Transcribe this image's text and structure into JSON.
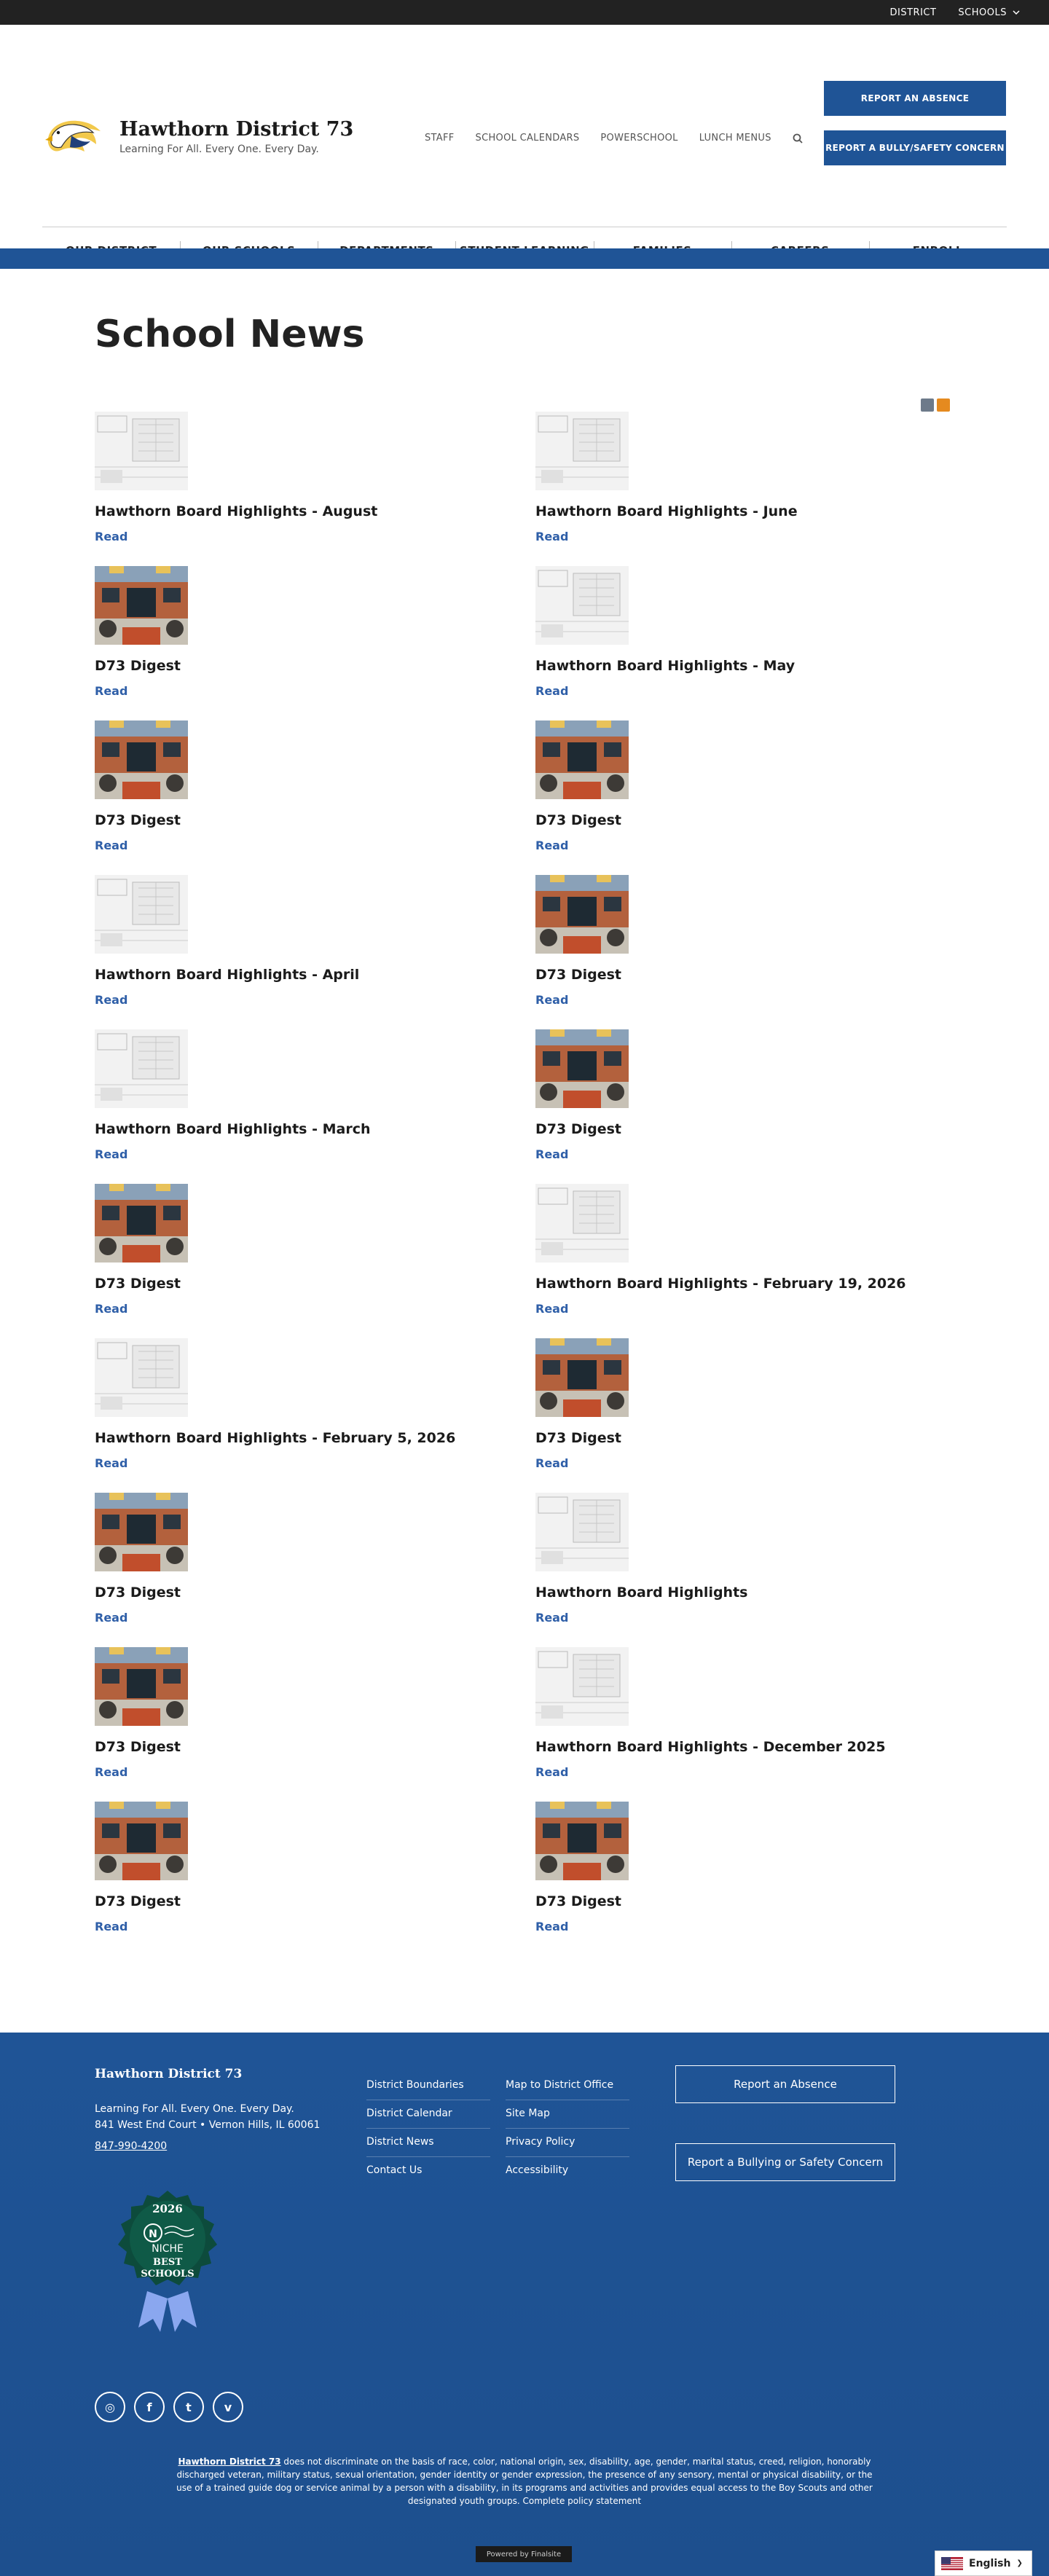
{
  "topbar": {
    "district": "DISTRICT",
    "schools": "SCHOOLS"
  },
  "brand": {
    "name": "Hawthorn District 73",
    "tagline": "Learning For All. Every One. Every Day."
  },
  "utility_nav": [
    "STAFF",
    "SCHOOL CALENDARS",
    "POWERSCHOOL",
    "LUNCH MENUS"
  ],
  "cta": {
    "absence": "REPORT AN ABSENCE",
    "bully": "REPORT A BULLY/SAFETY CONCERN"
  },
  "main_nav": [
    "OUR DISTRICT",
    "OUR SCHOOLS",
    "DEPARTMENTS",
    "STUDENT LEARNING",
    "FAMILIES",
    "CAREERS",
    "ENROLL"
  ],
  "page_title": "School News",
  "read_label": "Read",
  "news_left": [
    {
      "title": "Hawthorn Board Highlights - August",
      "thumb": "board"
    },
    {
      "title": "D73 Digest",
      "thumb": "school"
    },
    {
      "title": "D73 Digest",
      "thumb": "school"
    },
    {
      "title": "Hawthorn Board Highlights - April",
      "thumb": "board"
    },
    {
      "title": "Hawthorn Board Highlights - March",
      "thumb": "board"
    },
    {
      "title": "D73 Digest",
      "thumb": "school"
    },
    {
      "title": "Hawthorn Board Highlights - February 5, 2026",
      "thumb": "board"
    },
    {
      "title": "D73 Digest",
      "thumb": "school"
    },
    {
      "title": "D73 Digest",
      "thumb": "school"
    },
    {
      "title": "D73 Digest",
      "thumb": "school"
    }
  ],
  "news_right": [
    {
      "title": "Hawthorn Board Highlights - June",
      "thumb": "board"
    },
    {
      "title": "Hawthorn Board Highlights - May",
      "thumb": "board"
    },
    {
      "title": "D73 Digest",
      "thumb": "school"
    },
    {
      "title": "D73 Digest",
      "thumb": "school"
    },
    {
      "title": "D73 Digest",
      "thumb": "school"
    },
    {
      "title": "Hawthorn Board Highlights - February 19, 2026",
      "thumb": "board"
    },
    {
      "title": "D73 Digest",
      "thumb": "school"
    },
    {
      "title": "Hawthorn Board Highlights",
      "thumb": "board"
    },
    {
      "title": "Hawthorn Board Highlights - December 2025",
      "thumb": "board"
    },
    {
      "title": "D73 Digest",
      "thumb": "school"
    }
  ],
  "footer": {
    "name": "Hawthorn District 73",
    "tagline": "Learning For All. Every One. Every Day.",
    "address": "841 West End Court  •  Vernon Hills, IL  60061",
    "phone": "847-990-4200",
    "links_col1": [
      "District Boundaries",
      "District Calendar",
      "District News",
      "Contact Us"
    ],
    "links_col2": [
      "Map to District Office",
      "Site Map",
      "Privacy Policy",
      "Accessibility"
    ],
    "btn_absence": "Report an Absence",
    "btn_bully": "Report a Bullying or Safety Concern",
    "badge": {
      "year": "2026",
      "brand": "NICHE",
      "line1": "BEST",
      "line2": "SCHOOLS"
    },
    "social": [
      {
        "icon": "instagram-icon",
        "glyph": "◎"
      },
      {
        "icon": "facebook-icon",
        "glyph": "f"
      },
      {
        "icon": "twitter-icon",
        "glyph": "t"
      },
      {
        "icon": "vimeo-icon",
        "glyph": "v"
      }
    ],
    "legal_name": "Hawthorn District 73",
    "legal_text": " does not discriminate on the basis of race, color, national origin, sex, disability, age, gender, marital status, creed, religion, honorably discharged veteran, military status, sexual orientation, gender identity or gender expression, the presence of any sensory, mental or physical disability, or the use of a trained guide dog or service animal by a person with a disability, in its programs and activities and provides equal access to the Boy Scouts and other designated youth groups. Complete policy statement",
    "powered": "Powered by Finalsite"
  },
  "language": "English"
}
